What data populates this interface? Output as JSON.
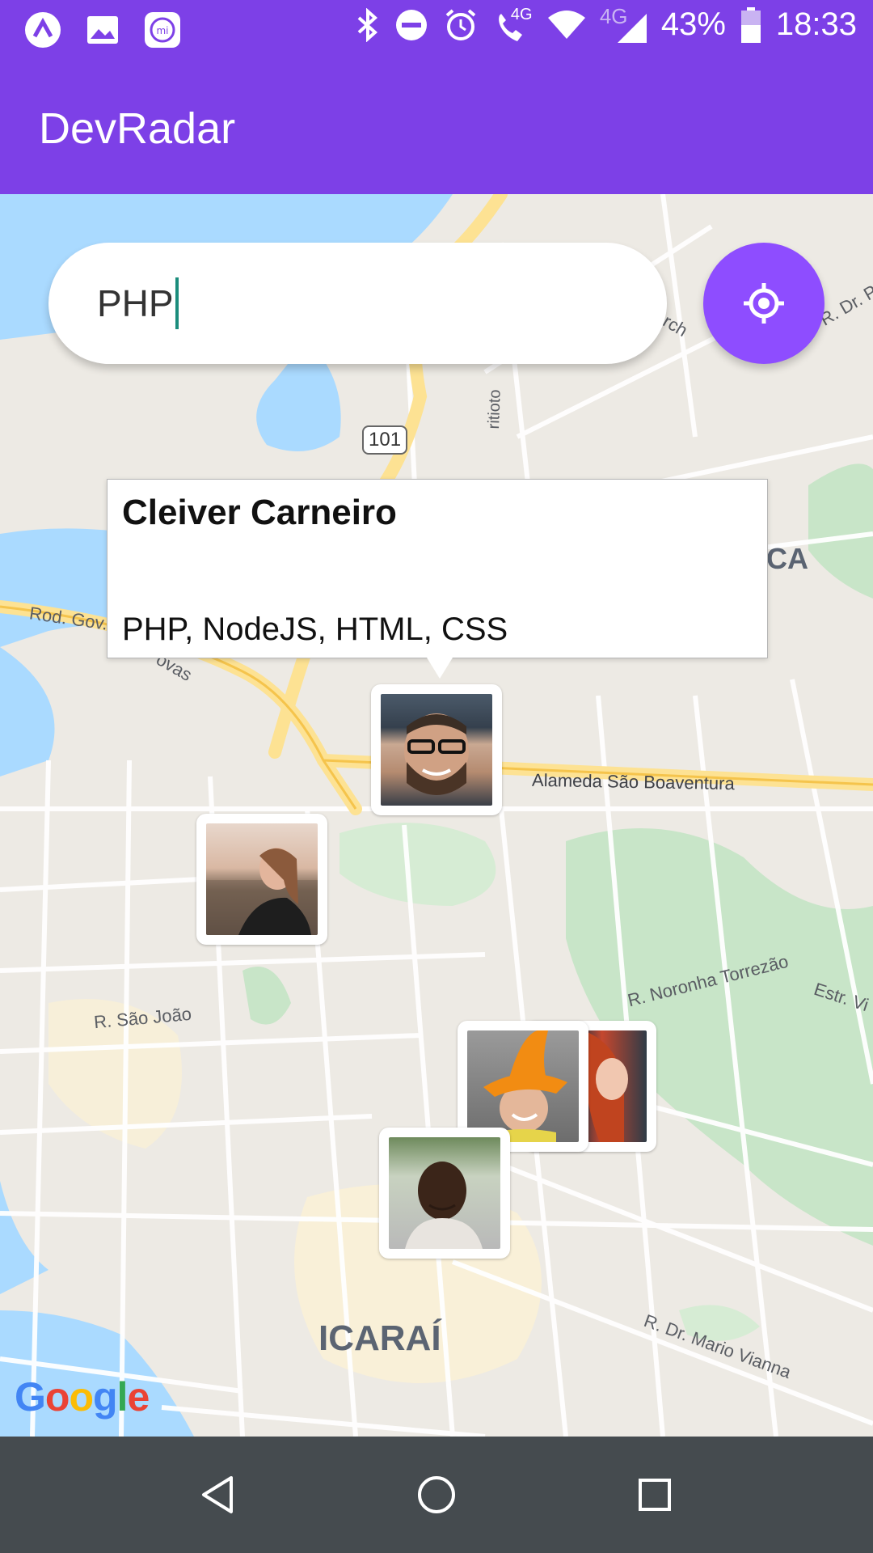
{
  "status_bar": {
    "battery": "43%",
    "time": "18:33",
    "network_label": "4G",
    "icons": [
      "app-icon",
      "gallery-icon",
      "mi-icon",
      "bluetooth-icon",
      "dnd-icon",
      "alarm-icon",
      "volte-call-icon",
      "wifi-icon",
      "signal-icon",
      "battery-icon"
    ]
  },
  "app_bar": {
    "title": "DevRadar"
  },
  "search": {
    "value": "PHP",
    "placeholder": ""
  },
  "locate_button": {
    "icon": "crosshair-icon"
  },
  "callout": {
    "name": "Cleiver Carneiro",
    "techs": "PHP, NodeJS, HTML, CSS"
  },
  "map": {
    "labels": {
      "rod_gov": "Rod. Gov.",
      "novas": "ovas",
      "route_101": "101",
      "alameda": "Alameda São Boaventura",
      "sao_joao": "R. São João",
      "noronha": "R. Noronha Torrezão",
      "estr": "Estr. Vi",
      "mario_vianna": "R. Dr. Mario Vianna",
      "icarai": "ICARAÍ",
      "ca": "CA",
      "dr_po": "R. Dr. Por",
      "rch": "rch",
      "trioto": "ritioto"
    },
    "attribution": "Google",
    "markers": [
      "developer-avatar-1",
      "developer-avatar-2",
      "developer-avatar-3",
      "developer-avatar-4",
      "developer-avatar-5"
    ]
  },
  "nav_bar": {
    "buttons": [
      "back-icon",
      "home-icon",
      "recents-icon"
    ]
  },
  "colors": {
    "primary": "#7D40E7",
    "accent": "#8E4DFF",
    "nav": "#454B4F"
  }
}
